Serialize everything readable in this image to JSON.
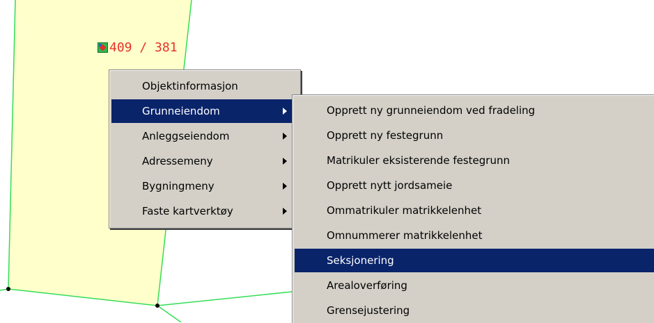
{
  "parcel_label": {
    "text": "409 / 381",
    "icon": "parcel-marker-icon"
  },
  "context_menu": {
    "items": [
      {
        "label": "Objektinformasjon",
        "has_submenu": false,
        "active": false
      },
      {
        "label": "Grunneiendom",
        "has_submenu": true,
        "active": true
      },
      {
        "label": "Anleggseiendom",
        "has_submenu": true,
        "active": false
      },
      {
        "label": "Adressemeny",
        "has_submenu": true,
        "active": false
      },
      {
        "label": "Bygningmeny",
        "has_submenu": true,
        "active": false
      },
      {
        "label": "Faste kartverktøy",
        "has_submenu": true,
        "active": false
      }
    ]
  },
  "submenu": {
    "items": [
      {
        "label": "Opprett ny grunneiendom ved fradeling",
        "active": false
      },
      {
        "label": "Opprett ny festegrunn",
        "active": false
      },
      {
        "label": "Matrikuler eksisterende festegrunn",
        "active": false
      },
      {
        "label": "Opprett nytt jordsameie",
        "active": false
      },
      {
        "label": "Ommatrikuler matrikkelenhet",
        "active": false
      },
      {
        "label": "Omnummerer matrikkelenhet",
        "active": false
      },
      {
        "label": "Seksjonering",
        "active": true
      },
      {
        "label": "Arealoverføring",
        "active": false
      },
      {
        "label": "Grensejustering",
        "active": false
      }
    ]
  },
  "colors": {
    "parcel_fill": "#ffffcc",
    "boundary_line": "#33dd55",
    "menu_bg": "#d4d0c8",
    "highlight": "#0a246a",
    "label_text": "#e8312a"
  }
}
